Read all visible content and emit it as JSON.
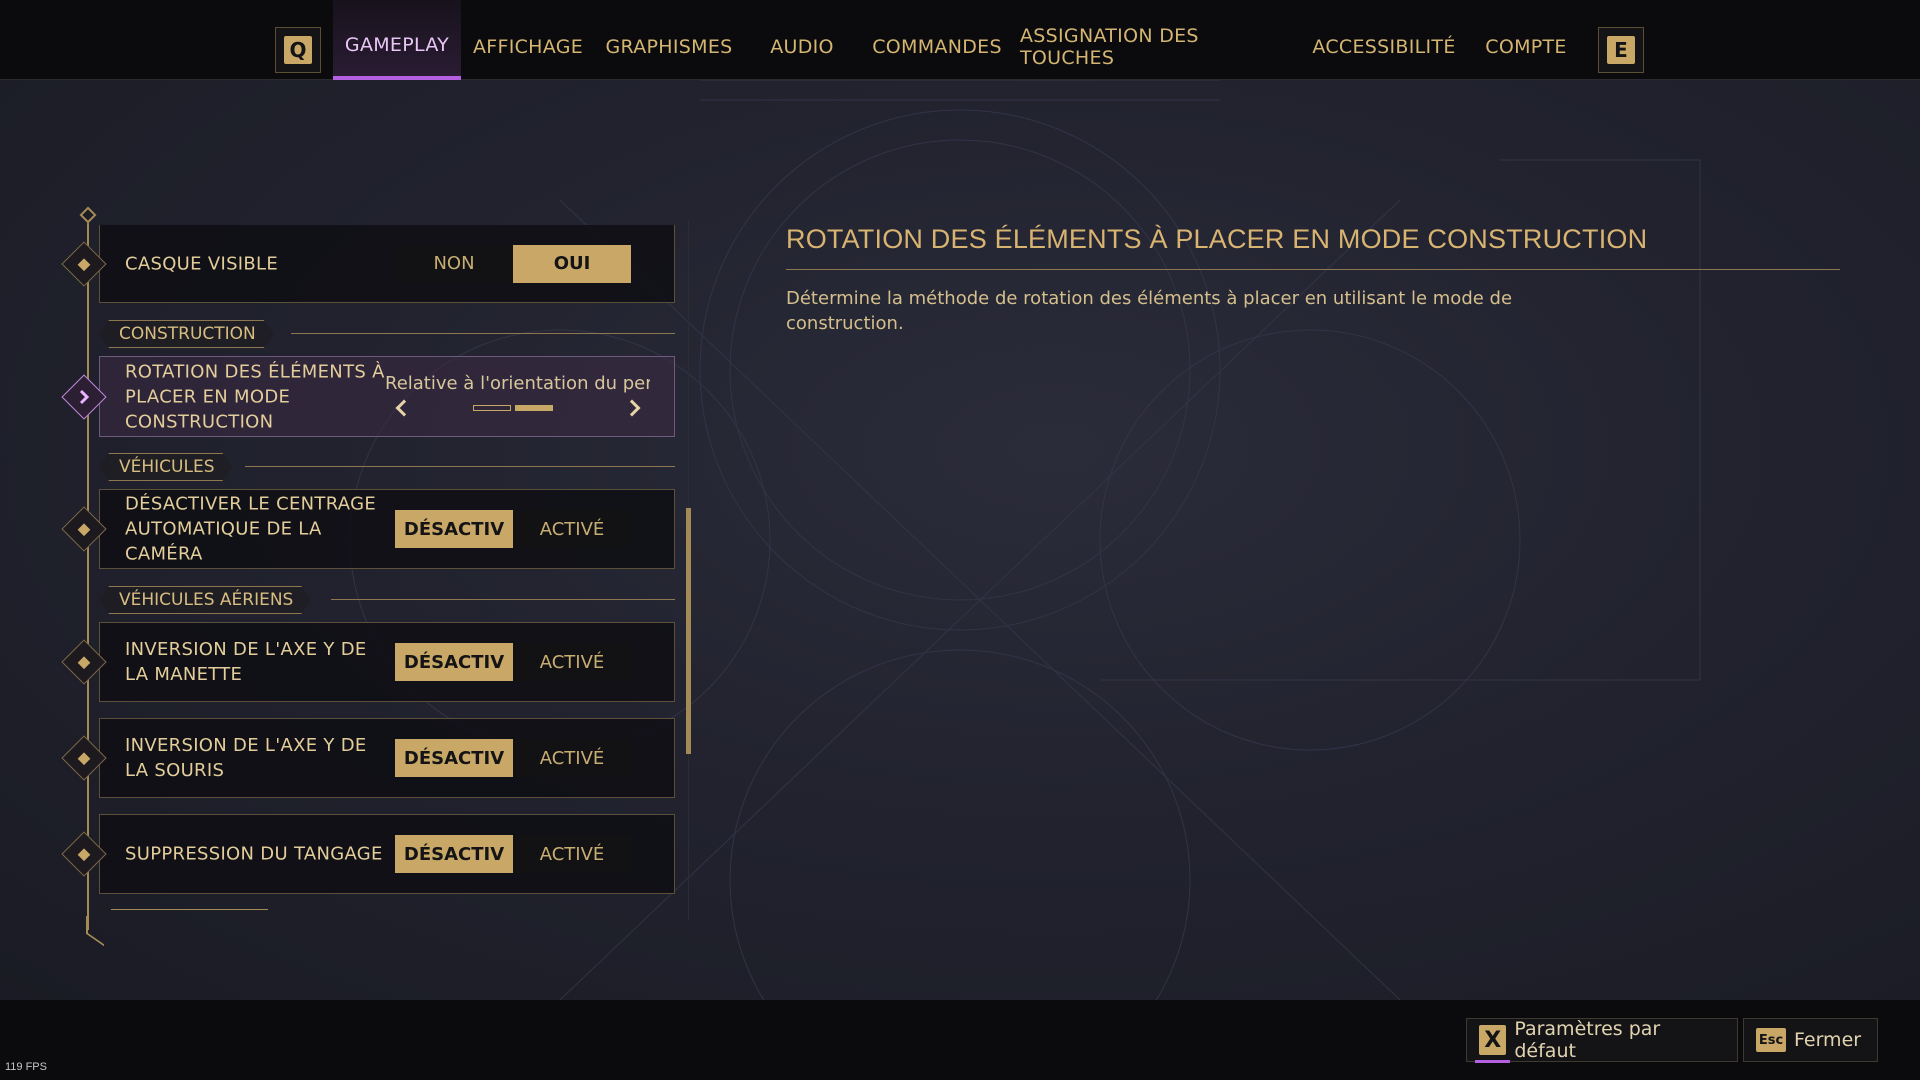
{
  "nav": {
    "left_key": "Q",
    "right_key": "E",
    "tabs": [
      {
        "label": "GAMEPLAY",
        "active": true
      },
      {
        "label": "AFFICHAGE",
        "active": false
      },
      {
        "label": "GRAPHISMES",
        "active": false
      },
      {
        "label": "AUDIO",
        "active": false
      },
      {
        "label": "COMMANDES",
        "active": false
      },
      {
        "label": "ASSIGNATION DES TOUCHES",
        "active": false
      },
      {
        "label": "ACCESSIBILITÉ",
        "active": false
      },
      {
        "label": "COMPTE",
        "active": false
      }
    ]
  },
  "settings": {
    "helmet": {
      "label": "CASQUE VISIBLE",
      "options": [
        "NON",
        "OUI"
      ],
      "selected": "OUI"
    },
    "construction_section": "CONSTRUCTION",
    "rotation": {
      "label": "ROTATION DES ÉLÉMENTS À PLACER EN MODE CONSTRUCTION",
      "value": "Relative à l'orientation du per",
      "page_count": 2,
      "current_page": 2
    },
    "vehicles_section": "VÉHICULES",
    "camera_centering": {
      "label": "DÉSACTIVER LE CENTRAGE AUTOMATIQUE DE LA CAMÉRA",
      "options": [
        "DÉSACTIV",
        "ACTIVÉ"
      ],
      "selected": "DÉSACTIV"
    },
    "air_section": "VÉHICULES AÉRIENS",
    "invert_pad": {
      "label": "INVERSION DE L'AXE Y DE LA MANETTE",
      "options": [
        "DÉSACTIV",
        "ACTIVÉ"
      ],
      "selected": "DÉSACTIV"
    },
    "invert_mouse": {
      "label": "INVERSION DE L'AXE Y DE LA SOURIS",
      "options": [
        "DÉSACTIV",
        "ACTIVÉ"
      ],
      "selected": "DÉSACTIV"
    },
    "pitch": {
      "label": "SUPPRESSION DU TANGAGE",
      "options": [
        "DÉSACTIV",
        "ACTIVÉ"
      ],
      "selected": "DÉSACTIV"
    }
  },
  "description": {
    "title": "ROTATION DES ÉLÉMENTS À PLACER EN MODE CONSTRUCTION",
    "text": "Détermine la méthode de rotation des éléments à placer en utilisant le mode de construction."
  },
  "footer": {
    "defaults_key": "X",
    "defaults_label": "Paramètres par défaut",
    "close_key": "Esc",
    "close_label": "Fermer",
    "fps": "119 FPS"
  },
  "colors": {
    "accent_gold": "#c9a867",
    "accent_purple": "#b560e0",
    "background": "#1b1c26"
  }
}
